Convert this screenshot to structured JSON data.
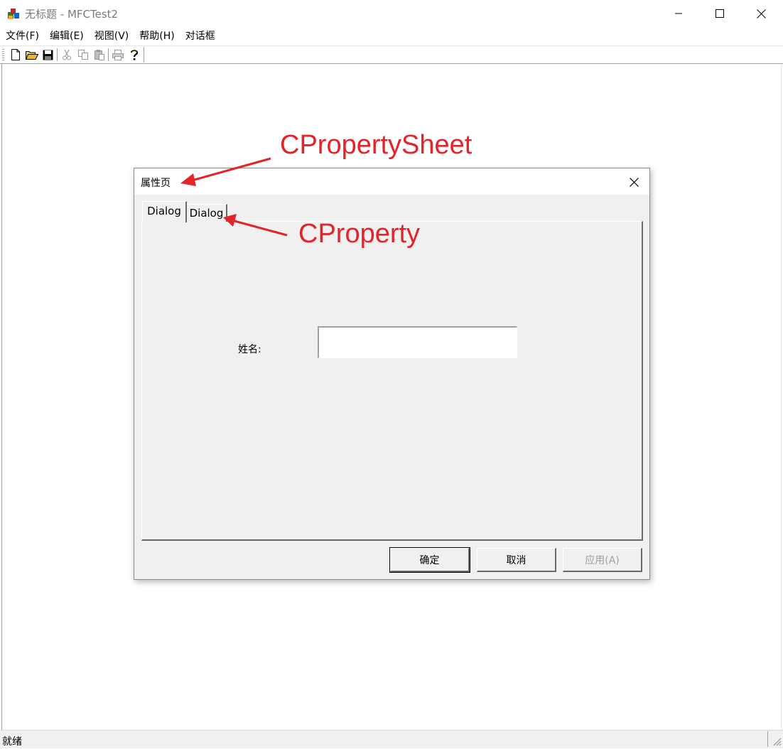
{
  "window": {
    "title": "无标题 - MFCTest2"
  },
  "menu": {
    "items": [
      "文件(F)",
      "编辑(E)",
      "视图(V)",
      "帮助(H)",
      "对话框"
    ]
  },
  "toolbar": {
    "buttons": [
      "new-icon",
      "open-folder-icon",
      "save-icon",
      "cut-icon",
      "copy-icon",
      "paste-icon",
      "print-icon",
      "help-icon"
    ]
  },
  "dialog": {
    "title": "属性页",
    "tabs": [
      "Dialog",
      "Dialog"
    ],
    "active_tab": 0,
    "name_label": "姓名:",
    "name_value": "",
    "buttons": {
      "ok": "确定",
      "cancel": "取消",
      "apply": "应用(A)"
    }
  },
  "status": {
    "text": "就绪"
  },
  "annotations": {
    "sheet": "CPropertySheet",
    "page": "CProperty",
    "color": "#e3242b"
  }
}
